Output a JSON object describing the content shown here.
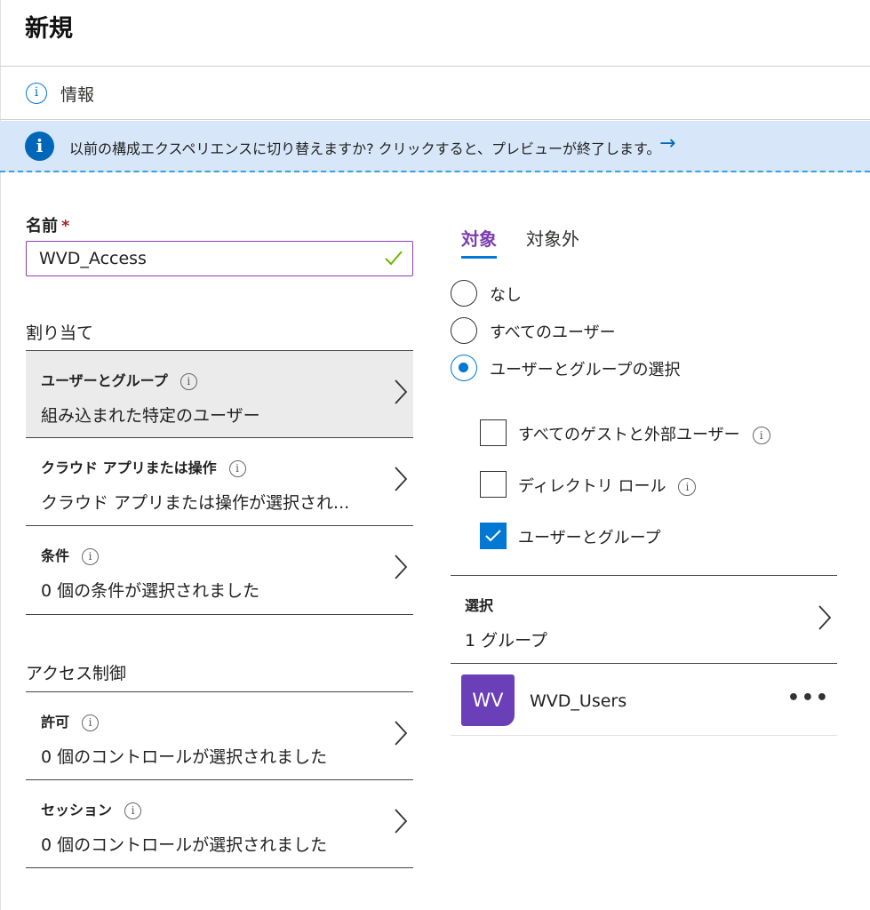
{
  "page": {
    "title": "新規",
    "info_label": "情報"
  },
  "banner": {
    "text": "以前の構成エクスペリエンスに切り替えますか? クリックすると、プレビューが終了します。",
    "arrow": "→"
  },
  "name_field": {
    "label": "名前",
    "required_marker": "*",
    "value": "WVD_Access"
  },
  "assignment": {
    "label": "割り当て",
    "rows": [
      {
        "title": "ユーザーとグループ",
        "value": "組み込まれた特定のユーザー"
      },
      {
        "title": "クラウド アプリまたは操作",
        "value": "クラウド アプリまたは操作が選択され..."
      },
      {
        "title": "条件",
        "value": "0 個の条件が選択されました"
      }
    ]
  },
  "access_control": {
    "label": "アクセス制御",
    "rows": [
      {
        "title": "許可",
        "value": "0 個のコントロールが選択されました"
      },
      {
        "title": "セッション",
        "value": "0 個のコントロールが選択されました"
      }
    ]
  },
  "tabs": [
    {
      "label": "対象",
      "active": true
    },
    {
      "label": "対象外",
      "active": false
    }
  ],
  "radios": [
    {
      "label": "なし",
      "checked": false
    },
    {
      "label": "すべてのユーザー",
      "checked": false
    },
    {
      "label": "ユーザーとグループの選択",
      "checked": true
    }
  ],
  "checkboxes": [
    {
      "label": "すべてのゲストと外部ユーザー",
      "checked": false,
      "info": true
    },
    {
      "label": "ディレクトリ ロール",
      "checked": false,
      "info": true
    },
    {
      "label": "ユーザーとグループ",
      "checked": true,
      "info": false
    }
  ],
  "selection": {
    "title": "選択",
    "value": "1 グループ"
  },
  "selected_group": {
    "avatar_initials": "WV",
    "name": "WVD_Users",
    "more": "•••"
  },
  "icons": {
    "info": "i",
    "chevron": "chevron-right-icon",
    "check": "checkmark-icon"
  },
  "colors": {
    "accent": "#0078d4",
    "purple": "#7d3fb0",
    "avatar": "#6b3fb8",
    "banner_bg": "#d7e6f8",
    "valid_check": "#6bb700"
  }
}
